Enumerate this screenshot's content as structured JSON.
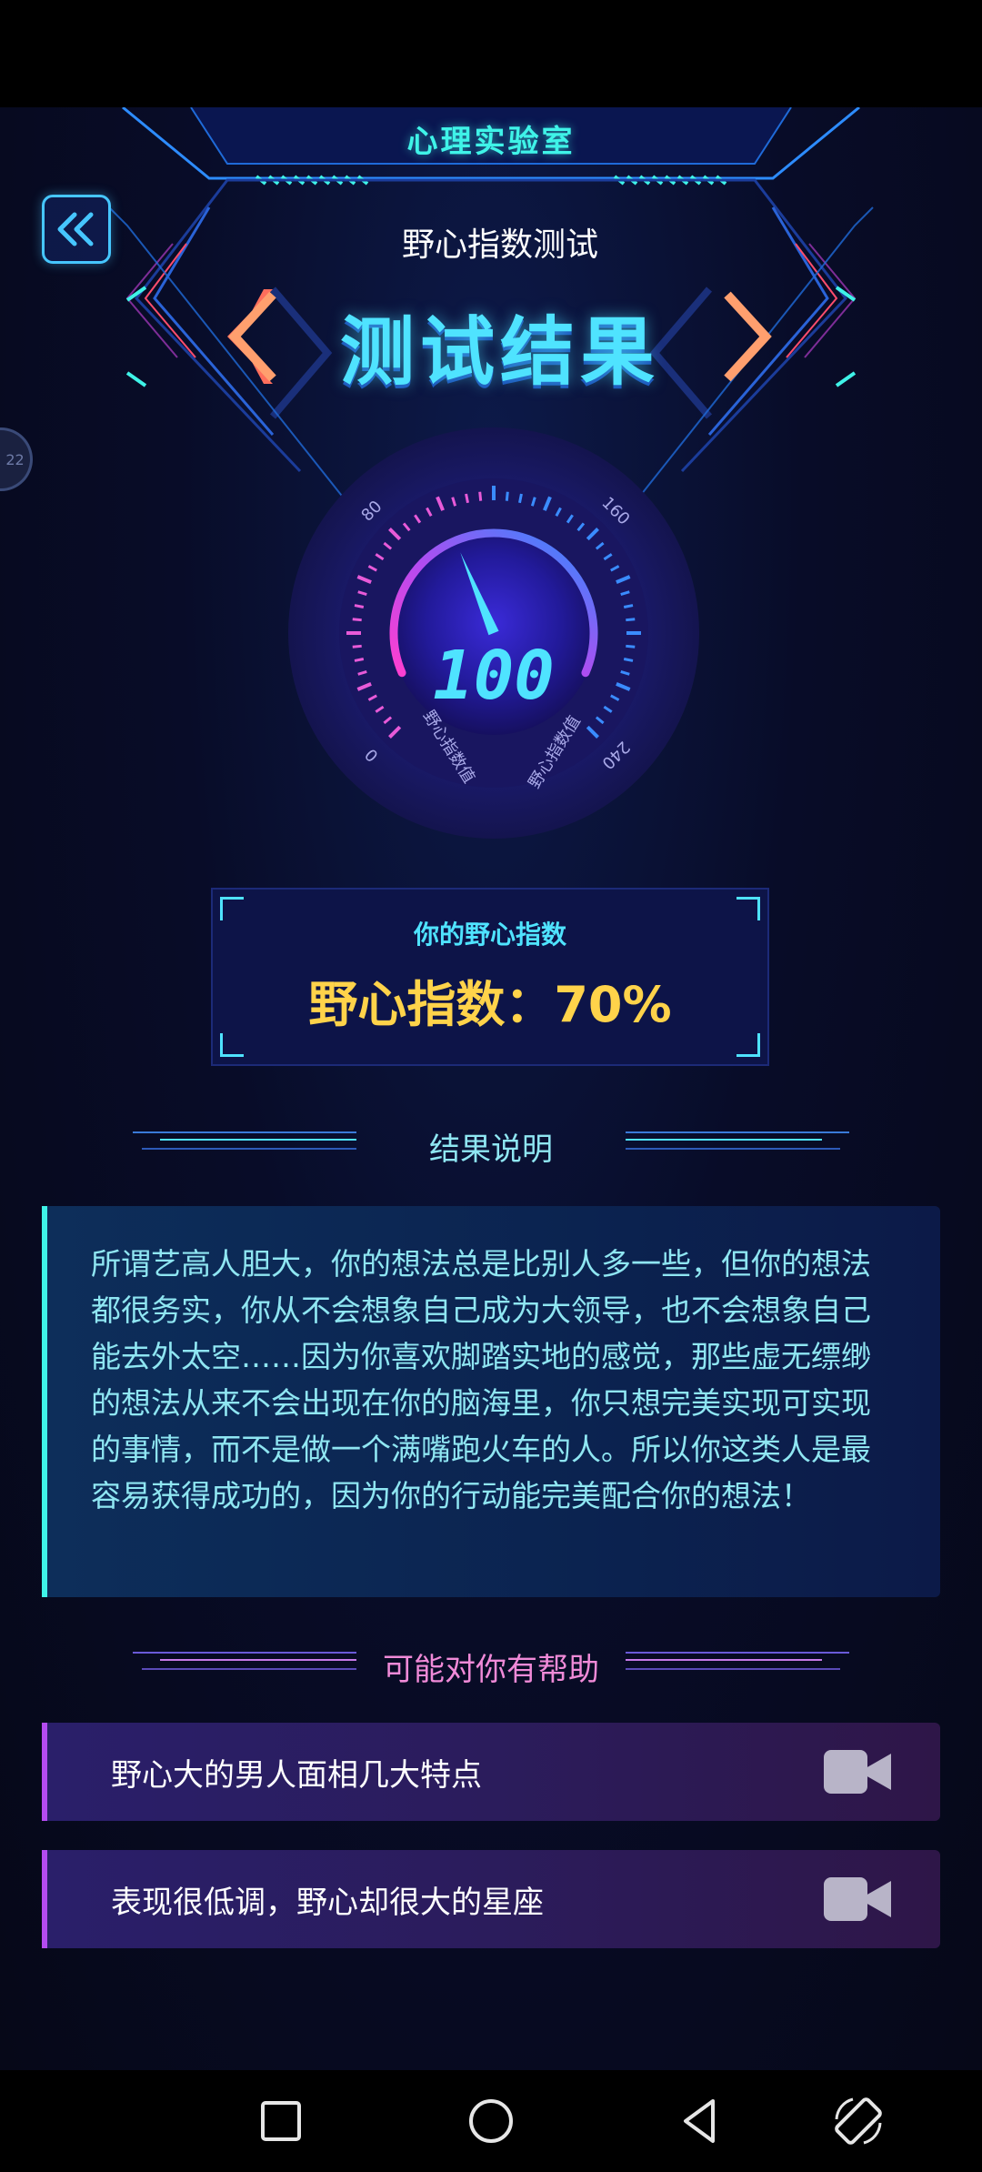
{
  "header": {
    "lab_title": "心理实验室",
    "test_name": "野心指数测试",
    "result_title": "测试结果",
    "side_tab": "22"
  },
  "gauge": {
    "value": "100",
    "needle_value": 100,
    "min": 0,
    "max": 240,
    "tick_labels": [
      "0",
      "80",
      "160",
      "240"
    ],
    "left_caption": "野心指数值",
    "right_caption": "野心指数值"
  },
  "score": {
    "label": "你的野心指数",
    "value": "野心指数：70%"
  },
  "result_section": {
    "title": "结果说明",
    "text": "所谓艺高人胆大，你的想法总是比别人多一些，但你的想法都很务实，你从不会想象自己成为大领导，也不会想象自己能去外太空……因为你喜欢脚踏实地的感觉，那些虚无缥缈的想法从来不会出现在你的脑海里，你只想完美实现可实现的事情，而不是做一个满嘴跑火车的人。所以你这类人是最容易获得成功的，因为你的行动能完美配合你的想法！"
  },
  "help_section": {
    "title": "可能对你有帮助",
    "items": [
      {
        "label": "野心大的男人面相几大特点",
        "icon": "video-icon"
      },
      {
        "label": "表现很低调，野心却很大的星座",
        "icon": "video-icon"
      }
    ]
  },
  "colors": {
    "cyan": "#3ff3e8",
    "gold": "#ffd34a",
    "pink_title": "#f08ad8",
    "purple_accent": "#b44bf0"
  }
}
